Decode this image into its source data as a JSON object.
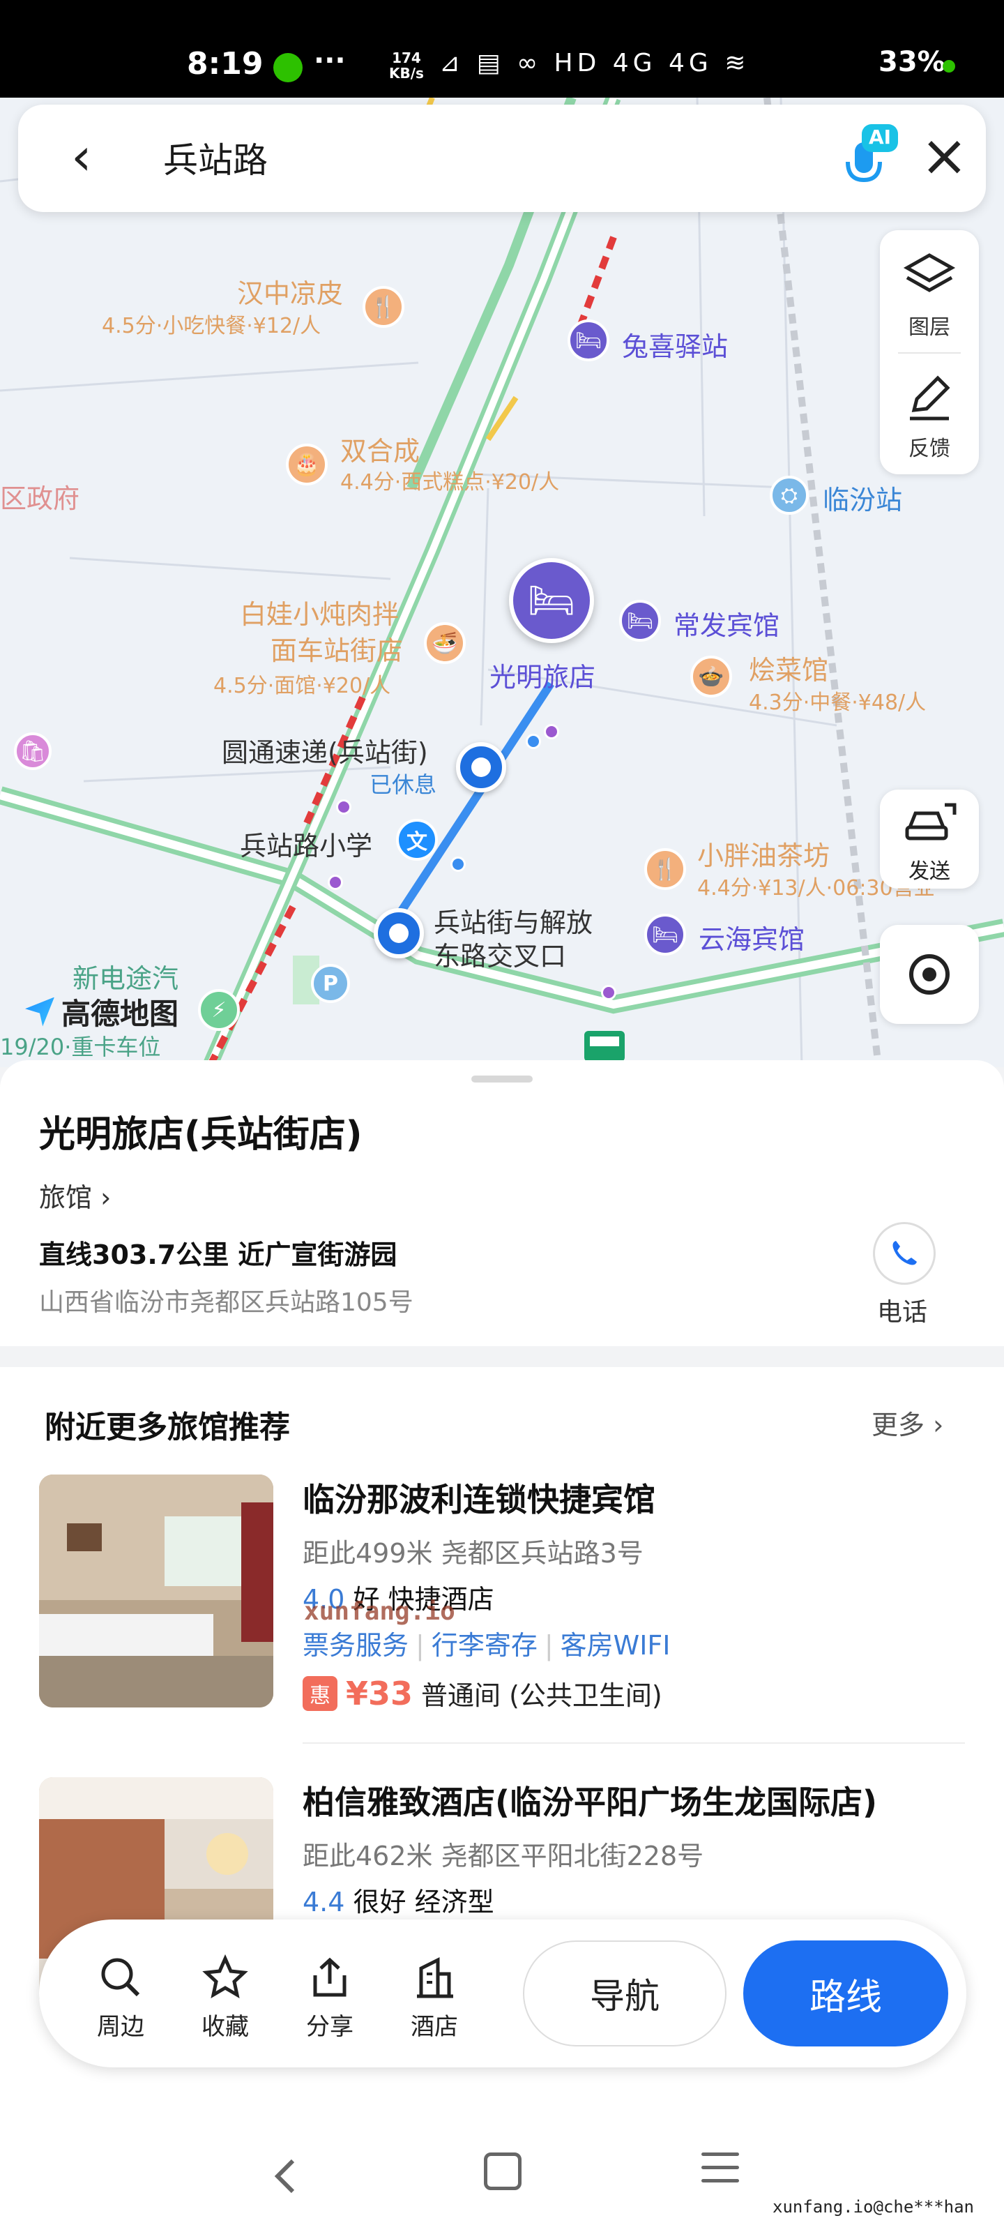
{
  "status_bar": {
    "time": "8:19",
    "more": "···",
    "net_speed_value": "174",
    "net_speed_unit": "KB/s",
    "icons": "⊿ ▤ ∞ HD 4G 4G ≋",
    "battery": "33%"
  },
  "search": {
    "query": "兵站路",
    "ai_badge": "AI"
  },
  "map": {
    "labels": {
      "hanzhong": "汉中凉皮",
      "hanzhong_sub": "4.5分·小吃快餐·¥12/人",
      "tuxi": "兔喜驿站",
      "shuanghe": "双合成",
      "shuanghe_sub": "4.4分·西式糕点·¥20/人",
      "zhengfu": "区政府",
      "linfen_station": "临汾站",
      "baiwa": "白娃小炖肉拌",
      "baiwa2": "面车站街店",
      "baiwa_sub": "4.5分·面馆·¥20/人",
      "changfa": "常发宾馆",
      "guangming": "光明旅店",
      "huicai": "烩菜馆",
      "huicai_sub": "4.3分·中餐·¥48/人",
      "yuantong": "圆通速递(兵站街)",
      "yuantong_status": "已休息",
      "school": "兵站路小学",
      "school_icon": "文",
      "xiaopang": "小胖油茶坊",
      "xiaopang_sub": "4.4分·¥13/人·06:30营业",
      "junction1": "兵站街与解放",
      "junction2": "东路交叉口",
      "yunhai": "云海宾馆",
      "xindian": "新电途汽",
      "truck": "19/20·重卡车位",
      "parking": "P"
    },
    "logo": "高德地图",
    "layers_label": "图层",
    "feedback_label": "反馈",
    "send_label": "发送"
  },
  "place": {
    "title": "光明旅店(兵站街店)",
    "category": "旅馆 ›",
    "distance": "直线303.7公里 近广宣街游园",
    "address": "山西省临汾市尧都区兵站路105号",
    "phone_label": "电话"
  },
  "recommendations": {
    "title": "附近更多旅馆推荐",
    "more": "更多 ›",
    "items": [
      {
        "name": "临汾那波利连锁快捷宾馆",
        "distance": "距此499米  尧都区兵站路3号",
        "score": "4.0",
        "rating_text": "好  快捷酒店",
        "tags": [
          "票务服务",
          "行李寄存",
          "客房WIFI"
        ],
        "hui": "惠",
        "price": "¥33",
        "room": "普通间 (公共卫生间)"
      },
      {
        "name": "柏信雅致酒店(临汾平阳广场生龙国际店)",
        "distance": "距此462米  尧都区平阳北街228号",
        "score": "4.4",
        "rating_text": "很好  经济型"
      }
    ]
  },
  "watermark": "xunfang.io",
  "actions": {
    "nearby": "周边",
    "favorite": "收藏",
    "share": "分享",
    "hotel": "酒店",
    "navigate": "导航",
    "route": "路线"
  },
  "credit": "xunfang.io@che***han"
}
